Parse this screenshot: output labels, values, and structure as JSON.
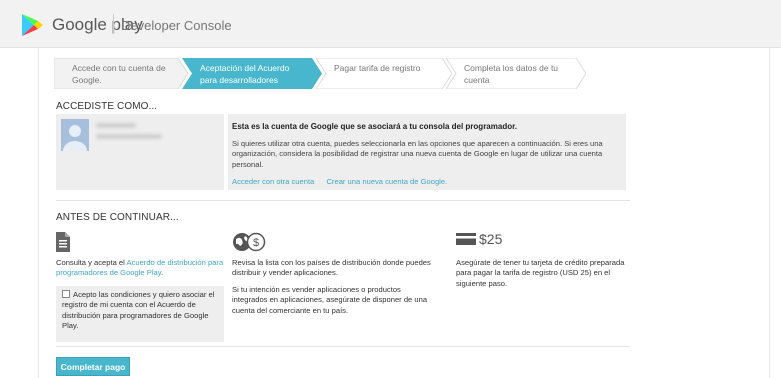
{
  "header": {
    "brand": "Google play",
    "product": "Developer Console"
  },
  "steps": [
    {
      "label": "Accede con tu cuenta de Google.",
      "state": "done"
    },
    {
      "label": "Aceptación del Acuerdo para desarrolladores",
      "state": "active"
    },
    {
      "label": "Pagar tarifa de registro",
      "state": "pending"
    },
    {
      "label": "Completa los datos de tu cuenta",
      "state": "pending"
    }
  ],
  "signed_in": {
    "title": "ACCEDISTE COMO...",
    "account_heading": "Esta es la cuenta de Google que se asociará a tu consola del programador.",
    "account_desc": "Si quieres utilizar otra cuenta, puedes seleccionarla en las opciones que aparecen a continuación. Si eres una organización, considera la posibilidad de registrar una nueva cuenta de Google en lugar de utilizar una cuenta personal.",
    "link_other": "Acceder con otra cuenta",
    "link_new": "Crear una nueva cuenta de Google."
  },
  "before": {
    "title": "ANTES DE CONTINUAR...",
    "col1_text_a": "Consulta y acepta el ",
    "col1_link": "Acuerdo de distribución para programadores de Google Play",
    "col1_text_b": ".",
    "agree_label": "Acepto las condiciones y quiero asociar el registro de mi cuenta con el Acuerdo de distribución para programadores de Google Play.",
    "agree_checked": false,
    "col2_p1": "Revisa la lista con los países de distribución donde puedes distribuir y vender aplicaciones.",
    "col2_p2": "Si tu intención es vender aplicaciones o productos integrados en aplicaciones, asegúrate de disponer de una cuenta del comerciante en tu país.",
    "price": "$25",
    "col3_text": "Asegúrate de tener tu tarjeta de crédito preparada para pagar la tarifa de registro (USD 25) en el siguiente paso."
  },
  "actions": {
    "pay_label": "Completar pago"
  },
  "icons": {
    "logo": "google-play-logo",
    "col1": "document-icon",
    "col2": "globe-dollar-icon",
    "col3": "credit-card-icon"
  },
  "colors": {
    "accent": "#48b6cd",
    "link": "#3fa7c3",
    "step_done": "#f2f2f2",
    "step_pending": "#ffffff"
  }
}
